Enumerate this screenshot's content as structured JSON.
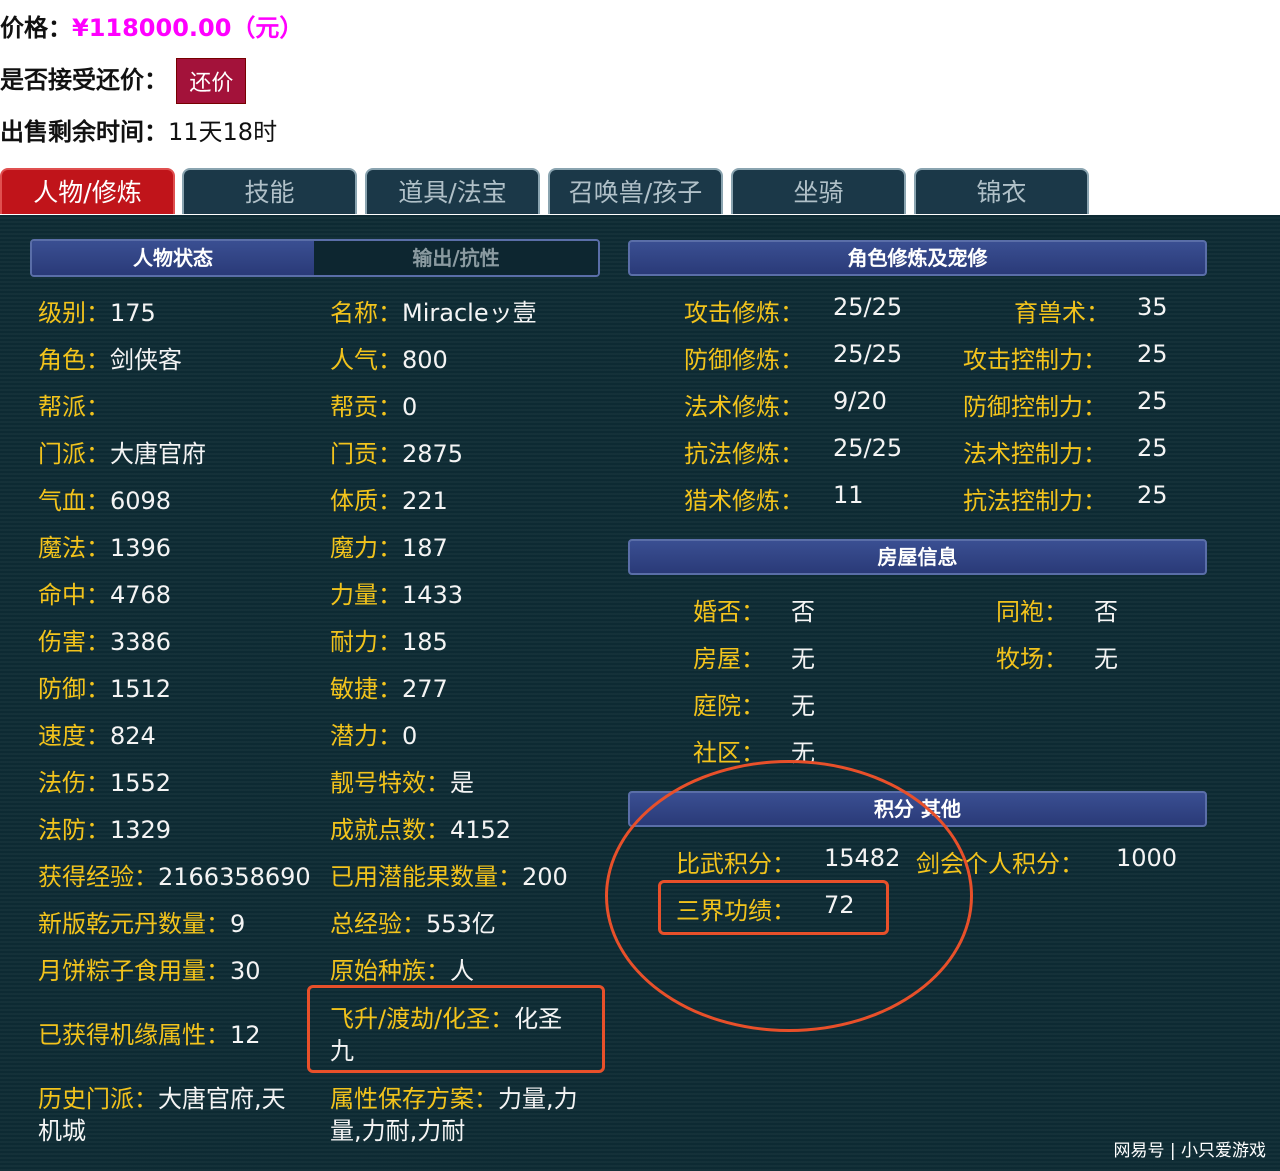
{
  "top": {
    "price_label": "价格：",
    "price_value": "¥118000.00（元）",
    "bargain_label": "是否接受还价：",
    "bargain_button": "还价",
    "remaining_label": "出售剩余时间：",
    "remaining_value": "11天18时"
  },
  "tabs": [
    "人物/修炼",
    "技能",
    "道具/法宝",
    "召唤兽/孩子",
    "坐骑",
    "锦衣"
  ],
  "headers": {
    "status": "人物状态",
    "output": "输出/抗性",
    "cultivation": "角色修炼及宠修",
    "house": "房屋信息",
    "score": "积分 其他"
  },
  "left_col": [
    {
      "label": "级别：",
      "value": "175"
    },
    {
      "label": "角色：",
      "value": "剑侠客"
    },
    {
      "label": "帮派：",
      "value": ""
    },
    {
      "label": "门派：",
      "value": "大唐官府"
    },
    {
      "label": "气血：",
      "value": "6098"
    },
    {
      "label": "魔法：",
      "value": "1396"
    },
    {
      "label": "命中：",
      "value": "4768"
    },
    {
      "label": "伤害：",
      "value": "3386"
    },
    {
      "label": "防御：",
      "value": "1512"
    },
    {
      "label": "速度：",
      "value": "824"
    },
    {
      "label": "法伤：",
      "value": "1552"
    },
    {
      "label": "法防：",
      "value": "1329"
    },
    {
      "label": "获得经验：",
      "value": "2166358690"
    },
    {
      "label": "新版乾元丹数量：",
      "value": "9"
    },
    {
      "label": "月饼粽子食用量：",
      "value": "30"
    },
    {
      "label": "已获得机缘属性：",
      "value": "12"
    },
    {
      "label": "历史门派：",
      "value": "大唐官府,天",
      "value2": "机城"
    }
  ],
  "mid_col": [
    {
      "label": "名称：",
      "value": "Miracleッ壹"
    },
    {
      "label": "人气：",
      "value": "800"
    },
    {
      "label": "帮贡：",
      "value": "0"
    },
    {
      "label": "门贡：",
      "value": "2875"
    },
    {
      "label": "体质：",
      "value": "221"
    },
    {
      "label": "魔力：",
      "value": "187"
    },
    {
      "label": "力量：",
      "value": "1433"
    },
    {
      "label": "耐力：",
      "value": "185"
    },
    {
      "label": "敏捷：",
      "value": "277"
    },
    {
      "label": "潜力：",
      "value": "0"
    },
    {
      "label": "靓号特效：",
      "value": "是"
    },
    {
      "label": "成就点数：",
      "value": "4152"
    },
    {
      "label": "已用潜能果数量：",
      "value": "200"
    },
    {
      "label": "总经验：",
      "value": "553亿"
    },
    {
      "label": "原始种族：",
      "value": "人"
    },
    {
      "label": "飞升/渡劫/化圣：",
      "value": "化圣",
      "value2": "九"
    },
    {
      "label": "属性保存方案：",
      "value": "力量,力",
      "value2": "量,力耐,力耐"
    }
  ],
  "cultivation": [
    {
      "label": "攻击修炼：",
      "value": "25/25",
      "label2": "育兽术：",
      "value2": "35"
    },
    {
      "label": "防御修炼：",
      "value": "25/25",
      "label2": "攻击控制力：",
      "value2": "25"
    },
    {
      "label": "法术修炼：",
      "value": "9/20",
      "label2": "防御控制力：",
      "value2": "25"
    },
    {
      "label": "抗法修炼：",
      "value": "25/25",
      "label2": "法术控制力：",
      "value2": "25"
    },
    {
      "label": "猎术修炼：",
      "value": "11",
      "label2": "抗法控制力：",
      "value2": "25"
    }
  ],
  "house": [
    {
      "label": "婚否：",
      "value": "否",
      "label2": "同袍：",
      "value2": "否"
    },
    {
      "label": "房屋：",
      "value": "无",
      "label2": "牧场：",
      "value2": "无"
    },
    {
      "label": "庭院：",
      "value": "无"
    },
    {
      "label": "社区：",
      "value": "无"
    }
  ],
  "score": [
    {
      "label": "比武积分：",
      "value": "15482",
      "label2": "剑会个人积分：",
      "value2": "1000"
    },
    {
      "label": "三界功绩：",
      "value": "72"
    }
  ],
  "watermark": "网易号 | 小只爱游戏",
  "colors": {
    "label": "#f2c31c",
    "value": "#f4f4f4",
    "highlight": "#e8502a",
    "price": "#ff00ff",
    "tab_active": "#c0141a"
  }
}
